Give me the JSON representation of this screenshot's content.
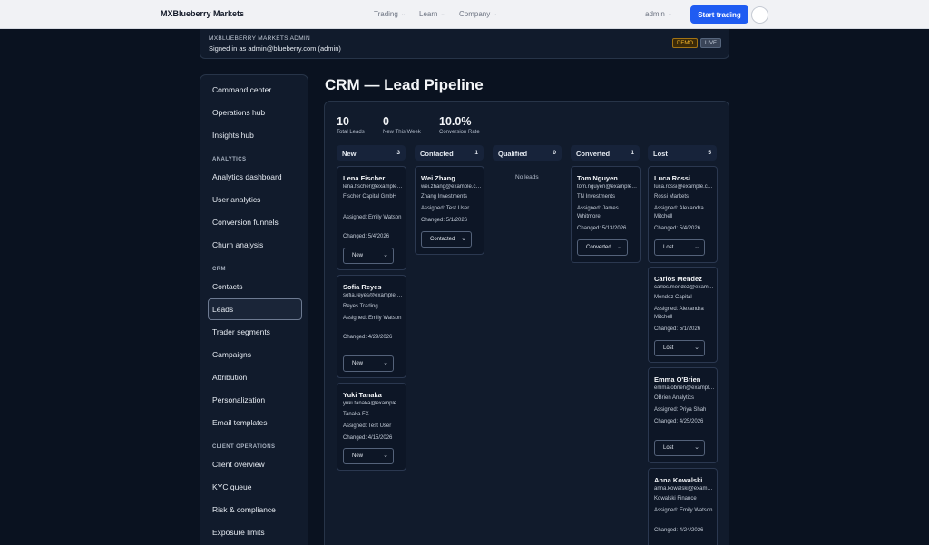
{
  "topbar": {
    "brand": "MXBlueberry Markets",
    "nav": [
      "Trading",
      "Learn",
      "Company"
    ],
    "admin_label": "admin",
    "cta_label": "Start trading",
    "more_label": "···"
  },
  "banner": {
    "kicker": "MXBLUEBERRY MARKETS ADMIN",
    "signed_in": "Signed in as admin@blueberry.com (admin)",
    "demo": "DEMO",
    "live": "LIVE"
  },
  "sidebar": {
    "items": {
      "command_center": "Command center",
      "operations_hub": "Operations hub",
      "insights_hub": "Insights hub",
      "analytics_dashboard": "Analytics dashboard",
      "user_analytics": "User analytics",
      "conversion_funnels": "Conversion funnels",
      "churn_analysis": "Churn analysis",
      "contacts": "Contacts",
      "leads": "Leads",
      "trader_segments": "Trader segments",
      "campaigns": "Campaigns",
      "attribution": "Attribution",
      "personalization": "Personalization",
      "email_templates": "Email templates",
      "client_overview": "Client overview",
      "kyc_queue": "KYC queue",
      "risk_compliance": "Risk & compliance",
      "exposure_limits": "Exposure limits"
    },
    "sections": {
      "analytics": "ANALYTICS",
      "crm": "CRM",
      "client_operations": "CLIENT OPERATIONS"
    },
    "active": "Leads"
  },
  "page": {
    "title": "CRM — Lead Pipeline"
  },
  "stats": [
    {
      "value": "10",
      "label": "Total Leads"
    },
    {
      "value": "0",
      "label": "New This Week"
    },
    {
      "value": "10.0%",
      "label": "Conversion Rate"
    }
  ],
  "columns": [
    {
      "title": "New",
      "count": "3"
    },
    {
      "title": "Contacted",
      "count": "1"
    },
    {
      "title": "Qualified",
      "count": "0"
    },
    {
      "title": "Converted",
      "count": "1"
    },
    {
      "title": "Lost",
      "count": "5"
    }
  ],
  "empty_text": "No leads",
  "cards": {
    "new": [
      {
        "name": "Lena Fischer",
        "email": "lena.fischer@example.com",
        "company": "Fischer Capital GmbH",
        "assigned": "Assigned: Emily Watson",
        "changed": "Changed: 5/4/2026",
        "stage": "New"
      },
      {
        "name": "Sofia Reyes",
        "email": "sofia.reyes@example.com",
        "company": "Reyes Trading",
        "assigned": "Assigned: Emily Watson",
        "changed": "Changed: 4/29/2026",
        "stage": "New"
      },
      {
        "name": "Yuki Tanaka",
        "email": "yuki.tanaka@example.com",
        "company": "Tanaka FX",
        "assigned": "Assigned: Test User",
        "changed": "Changed: 4/15/2026",
        "stage": "New"
      }
    ],
    "contacted": [
      {
        "name": "Wei Zhang",
        "email": "wei.zhang@example.com",
        "company": "Zhang Investments",
        "assigned": "Assigned: Test User",
        "changed": "Changed: 5/1/2026",
        "stage": "Contacted"
      }
    ],
    "converted": [
      {
        "name": "Tom Nguyen",
        "email": "tom.nguyen@example.com",
        "company": "TN Investments",
        "assigned": "Assigned: James Whitmore",
        "changed": "Changed: 5/13/2026",
        "stage": "Converted"
      }
    ],
    "lost": [
      {
        "name": "Luca Rossi",
        "email": "luca.rossi@example.com",
        "company": "Rossi Markets",
        "assigned": "Assigned: Alexandra Mitchell",
        "changed": "Changed: 5/4/2026",
        "stage": "Lost"
      },
      {
        "name": "Carlos Mendez",
        "email": "carlos.mendez@example.com",
        "company": "Mendez Capital",
        "assigned": "Assigned: Alexandra Mitchell",
        "changed": "Changed: 5/1/2026",
        "stage": "Lost"
      },
      {
        "name": "Emma O'Brien",
        "email": "emma.obrien@example.com",
        "company": "OBrien Analytics",
        "assigned": "Assigned: Priya Shah",
        "changed": "Changed: 4/25/2026",
        "stage": "Lost"
      },
      {
        "name": "Anna Kowalski",
        "email": "anna.kowalski@example.com",
        "company": "Kowalski Finance",
        "assigned": "Assigned: Emily Watson",
        "changed": "Changed: 4/24/2026",
        "stage": "Lost"
      }
    ]
  }
}
